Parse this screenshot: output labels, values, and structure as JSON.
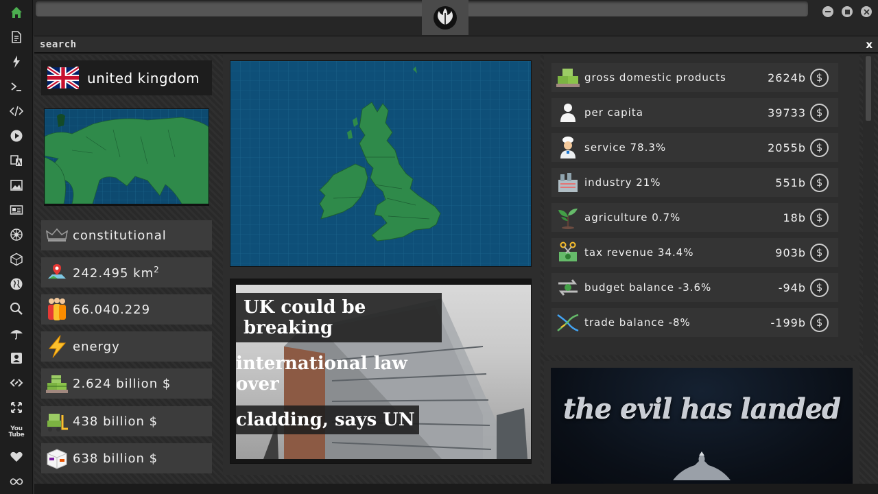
{
  "sidebar": {
    "items": [
      {
        "icon": "home-icon",
        "active": true
      },
      {
        "icon": "document-icon"
      },
      {
        "icon": "lightning-icon"
      },
      {
        "icon": "terminal-icon"
      },
      {
        "icon": "code-icon"
      },
      {
        "icon": "play-icon"
      },
      {
        "icon": "translate-icon"
      },
      {
        "icon": "image-icon"
      },
      {
        "icon": "newspaper-icon"
      },
      {
        "icon": "empire-icon"
      },
      {
        "icon": "cube-icon"
      },
      {
        "icon": "globe-icon"
      },
      {
        "icon": "search-icon"
      },
      {
        "icon": "umbrella-icon"
      },
      {
        "icon": "contact-icon"
      },
      {
        "icon": "link-icon"
      },
      {
        "icon": "fullscreen-icon"
      },
      {
        "icon": "youtube-icon"
      },
      {
        "icon": "heart-icon"
      },
      {
        "icon": "infinity-icon"
      }
    ],
    "youtube_label": "You Tube"
  },
  "search": {
    "label": "search",
    "close": "x"
  },
  "country": {
    "name": "united kingdom",
    "government": "constitutional",
    "area": "242.495 km",
    "area_unit_sup": "2",
    "population": "66.040.229",
    "category": "energy",
    "gdp_total": "2.624 billion $",
    "value_2": "438 billion $",
    "value_3": "638 billion $"
  },
  "news": {
    "lines": [
      "UK could be breaking",
      "international law over",
      "cladding, says UN"
    ]
  },
  "stats": [
    {
      "label": "gross domestic products",
      "value": "2624b",
      "icon": "money-pallet-icon"
    },
    {
      "label": "per capita",
      "value": "39733",
      "icon": "person-icon"
    },
    {
      "label": "service 78.3%",
      "value": "2055b",
      "icon": "chef-icon"
    },
    {
      "label": "industry 21%",
      "value": "551b",
      "icon": "factory-icon"
    },
    {
      "label": "agriculture 0.7%",
      "value": "18b",
      "icon": "sprout-icon"
    },
    {
      "label": "tax revenue 34.4%",
      "value": "903b",
      "icon": "tax-scissors-icon"
    },
    {
      "label": "budget balance -3.6%",
      "value": "-94b",
      "icon": "balance-arrows-icon"
    },
    {
      "label": "trade balance -8%",
      "value": "-199b",
      "icon": "trade-cross-icon"
    }
  ],
  "coin_symbol": "$",
  "banner": {
    "text": "the evil has landed"
  },
  "colors": {
    "accent": "#4caf50",
    "map_water": "#0e4f78",
    "map_land": "#2f8a4a"
  }
}
